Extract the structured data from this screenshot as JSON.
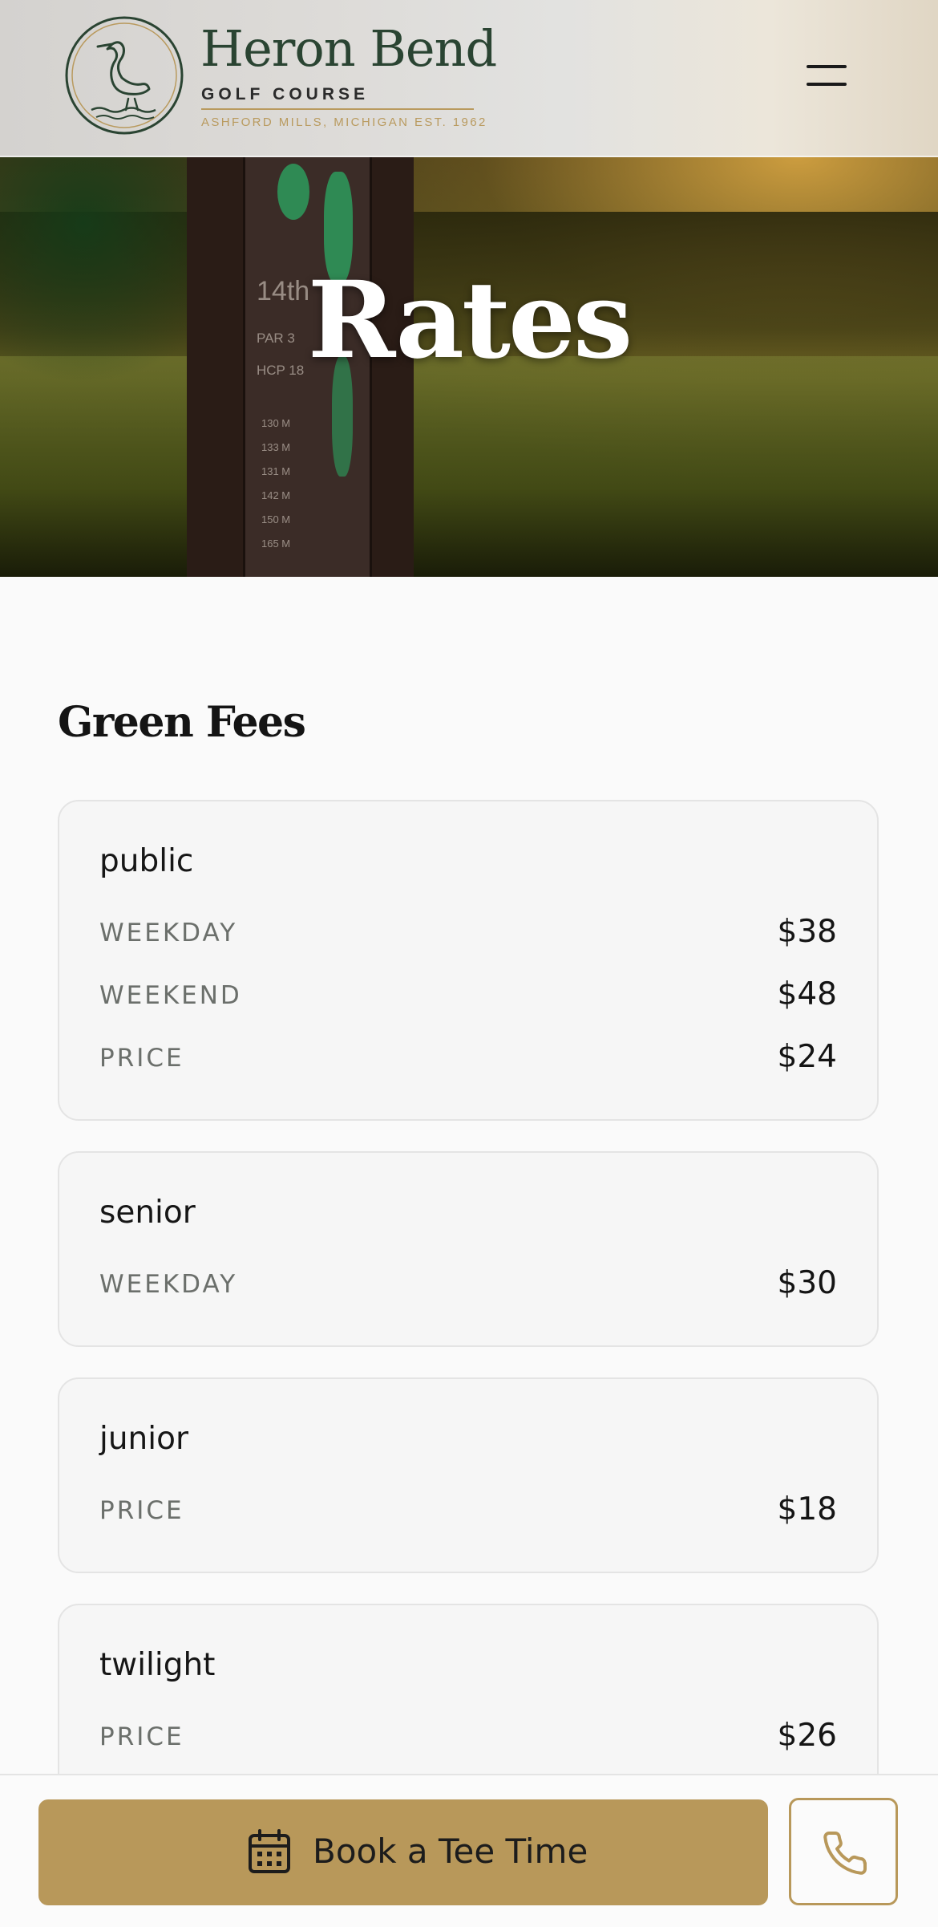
{
  "header": {
    "brand_name": "Heron Bend",
    "brand_sub": "GOLF COURSE",
    "brand_location": "ASHFORD MILLS, MICHIGAN EST. 1962",
    "menu_icon": "hamburger-menu-icon",
    "logo_icon": "heron-emblem-icon"
  },
  "hero": {
    "title": "Rates",
    "sign": {
      "hole": "14th",
      "par": "PAR 3",
      "hcp": "HCP 18",
      "yardages": [
        "130 M",
        "133 M",
        "131 M",
        "142 M",
        "150 M",
        "165 M"
      ]
    }
  },
  "green_fees": {
    "title": "Green Fees",
    "cards": [
      {
        "title": "public",
        "rows": [
          {
            "label": "WEEKDAY",
            "price": "$38"
          },
          {
            "label": "WEEKEND",
            "price": "$48"
          },
          {
            "label": "PRICE",
            "price": "$24"
          }
        ]
      },
      {
        "title": "senior",
        "rows": [
          {
            "label": "WEEKDAY",
            "price": "$30"
          }
        ]
      },
      {
        "title": "junior",
        "rows": [
          {
            "label": "PRICE",
            "price": "$18"
          }
        ]
      },
      {
        "title": "twilight",
        "rows": [
          {
            "label": "PRICE",
            "price": "$26"
          }
        ]
      }
    ]
  },
  "bottom_bar": {
    "book_label": "Book a Tee Time",
    "book_icon": "calendar-icon",
    "call_icon": "phone-icon"
  },
  "colors": {
    "accent_gold": "#b8985a",
    "brand_green": "#2a4432",
    "card_bg": "#f6f6f6",
    "label_gray": "#6b6f6b"
  }
}
